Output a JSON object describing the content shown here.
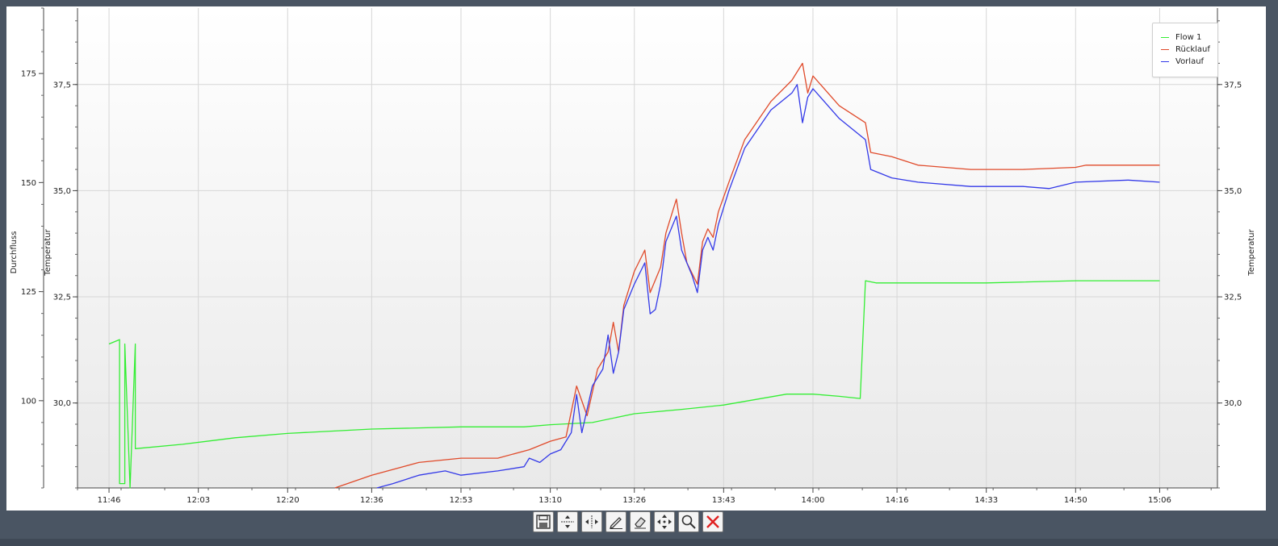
{
  "chart_data": {
    "type": "line",
    "x_ticks": [
      "11:46",
      "12:03",
      "12:20",
      "12:36",
      "12:53",
      "13:10",
      "13:26",
      "13:43",
      "14:00",
      "14:16",
      "14:33",
      "14:50",
      "15:06"
    ],
    "x_range": [
      "11:40",
      "15:17"
    ],
    "y_left_label": "Durchfluss",
    "y_left_ticks": [
      "100",
      "125",
      "150",
      "175"
    ],
    "y_left_range": [
      80,
      190
    ],
    "y_temp_label": "Temperatur",
    "y_temp_ticks": [
      "30,0",
      "32,5",
      "35,0",
      "37,5"
    ],
    "y_temp_range": [
      28.0,
      39.3
    ],
    "y_right_label": "Temperatur",
    "y_right_ticks": [
      "30,0",
      "32,5",
      "35,0",
      "37,5"
    ],
    "grid": true,
    "legend_position": "top-right",
    "series": [
      {
        "name": "Flow 1",
        "axis": "Durchfluss",
        "color": "#33ee33",
        "points": [
          [
            "11:46",
            113
          ],
          [
            "11:48",
            114
          ],
          [
            "11:48",
            81
          ],
          [
            "11:49",
            81
          ],
          [
            "11:49",
            113
          ],
          [
            "11:50",
            80
          ],
          [
            "11:51",
            113
          ],
          [
            "11:51",
            89
          ],
          [
            "12:00",
            90
          ],
          [
            "12:10",
            91.5
          ],
          [
            "12:20",
            92.5
          ],
          [
            "12:36",
            93.5
          ],
          [
            "12:53",
            94
          ],
          [
            "13:05",
            94
          ],
          [
            "13:10",
            94.5
          ],
          [
            "13:18",
            95
          ],
          [
            "13:26",
            97
          ],
          [
            "13:35",
            98
          ],
          [
            "13:43",
            99
          ],
          [
            "13:55",
            101.5
          ],
          [
            "14:00",
            101.5
          ],
          [
            "14:05",
            101
          ],
          [
            "14:09",
            100.5
          ],
          [
            "14:10",
            127.5
          ],
          [
            "14:12",
            127
          ],
          [
            "14:15",
            127
          ],
          [
            "14:16",
            127
          ],
          [
            "14:33",
            127
          ],
          [
            "14:50",
            127.5
          ],
          [
            "15:06",
            127.5
          ]
        ]
      },
      {
        "name": "Rücklauf",
        "axis": "Temperatur",
        "color": "#e04a2a",
        "points": [
          [
            "12:29",
            28
          ],
          [
            "12:36",
            28.3
          ],
          [
            "12:45",
            28.6
          ],
          [
            "12:53",
            28.7
          ],
          [
            "13:00",
            28.7
          ],
          [
            "13:06",
            28.9
          ],
          [
            "13:10",
            29.1
          ],
          [
            "13:13",
            29.2
          ],
          [
            "13:15",
            30.4
          ],
          [
            "13:17",
            29.7
          ],
          [
            "13:19",
            30.8
          ],
          [
            "13:21",
            31.2
          ],
          [
            "13:22",
            31.9
          ],
          [
            "13:23",
            31.2
          ],
          [
            "13:24",
            32.3
          ],
          [
            "13:26",
            33.1
          ],
          [
            "13:28",
            33.6
          ],
          [
            "13:29",
            32.6
          ],
          [
            "13:31",
            33.2
          ],
          [
            "13:32",
            34.0
          ],
          [
            "13:34",
            34.8
          ],
          [
            "13:35",
            34.0
          ],
          [
            "13:36",
            33.3
          ],
          [
            "13:38",
            32.8
          ],
          [
            "13:39",
            33.8
          ],
          [
            "13:40",
            34.1
          ],
          [
            "13:41",
            33.9
          ],
          [
            "13:42",
            34.5
          ],
          [
            "13:44",
            35.2
          ],
          [
            "13:47",
            36.2
          ],
          [
            "13:52",
            37.1
          ],
          [
            "13:56",
            37.6
          ],
          [
            "13:58",
            38.0
          ],
          [
            "13:59",
            37.3
          ],
          [
            "14:00",
            37.7
          ],
          [
            "14:05",
            37.0
          ],
          [
            "14:10",
            36.6
          ],
          [
            "14:11",
            35.9
          ],
          [
            "14:15",
            35.8
          ],
          [
            "14:20",
            35.6
          ],
          [
            "14:30",
            35.5
          ],
          [
            "14:40",
            35.5
          ],
          [
            "14:50",
            35.55
          ],
          [
            "14:52",
            35.6
          ],
          [
            "15:00",
            35.6
          ],
          [
            "15:06",
            35.6
          ]
        ]
      },
      {
        "name": "Vorlauf",
        "axis": "Temperatur",
        "color": "#3339e8",
        "points": [
          [
            "12:37",
            28
          ],
          [
            "12:40",
            28.1
          ],
          [
            "12:45",
            28.3
          ],
          [
            "12:50",
            28.4
          ],
          [
            "12:53",
            28.3
          ],
          [
            "13:00",
            28.4
          ],
          [
            "13:05",
            28.5
          ],
          [
            "13:06",
            28.7
          ],
          [
            "13:08",
            28.6
          ],
          [
            "13:10",
            28.8
          ],
          [
            "13:12",
            28.9
          ],
          [
            "13:14",
            29.3
          ],
          [
            "13:15",
            30.2
          ],
          [
            "13:16",
            29.3
          ],
          [
            "13:18",
            30.4
          ],
          [
            "13:20",
            30.8
          ],
          [
            "13:21",
            31.6
          ],
          [
            "13:22",
            30.7
          ],
          [
            "13:23",
            31.2
          ],
          [
            "13:24",
            32.2
          ],
          [
            "13:26",
            32.8
          ],
          [
            "13:28",
            33.3
          ],
          [
            "13:29",
            32.1
          ],
          [
            "13:30",
            32.2
          ],
          [
            "13:31",
            32.8
          ],
          [
            "13:32",
            33.8
          ],
          [
            "13:34",
            34.4
          ],
          [
            "13:35",
            33.6
          ],
          [
            "13:37",
            33.0
          ],
          [
            "13:38",
            32.6
          ],
          [
            "13:39",
            33.6
          ],
          [
            "13:40",
            33.9
          ],
          [
            "13:41",
            33.6
          ],
          [
            "13:42",
            34.2
          ],
          [
            "13:44",
            35.0
          ],
          [
            "13:47",
            36.0
          ],
          [
            "13:52",
            36.9
          ],
          [
            "13:56",
            37.3
          ],
          [
            "13:57",
            37.5
          ],
          [
            "13:58",
            36.6
          ],
          [
            "13:59",
            37.2
          ],
          [
            "14:00",
            37.4
          ],
          [
            "14:05",
            36.7
          ],
          [
            "14:10",
            36.2
          ],
          [
            "14:11",
            35.5
          ],
          [
            "14:15",
            35.3
          ],
          [
            "14:20",
            35.2
          ],
          [
            "14:30",
            35.1
          ],
          [
            "14:40",
            35.1
          ],
          [
            "14:45",
            35.05
          ],
          [
            "14:50",
            35.2
          ],
          [
            "15:00",
            35.25
          ],
          [
            "15:06",
            35.2
          ]
        ]
      }
    ]
  },
  "toolbar": {
    "buttons": [
      {
        "icon": "save-icon"
      },
      {
        "icon": "zoom-vertical-icon"
      },
      {
        "icon": "zoom-horizontal-icon"
      },
      {
        "icon": "edit-icon"
      },
      {
        "icon": "erase-icon"
      },
      {
        "icon": "pan-icon"
      },
      {
        "icon": "magnify-icon"
      },
      {
        "icon": "close-icon",
        "color": "#e02020"
      }
    ]
  }
}
